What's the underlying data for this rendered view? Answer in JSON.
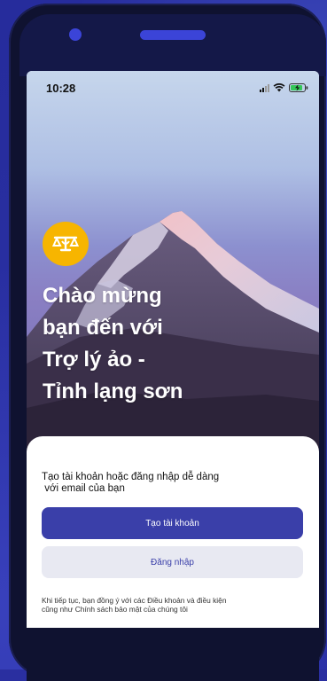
{
  "status_bar": {
    "time": "10:28",
    "icons": [
      "signal-icon",
      "wifi-icon",
      "battery-charging-icon"
    ]
  },
  "hero": {
    "badge_icon": "scales-icon",
    "title_lines": [
      "Chào mừng",
      "bạn đến với",
      "Trợ lý ảo -",
      "Tỉnh lạng sơn"
    ]
  },
  "sheet": {
    "subtitle_lines": [
      "Tạo tài khoản hoặc đăng nhập dễ dàng",
      " với email của bạn"
    ],
    "create_account_label": "Tạo tài khoản",
    "login_label": "Đăng nhập",
    "terms_lines": [
      "Khi tiếp tục, bạn đồng ý với các Điều khoản và điều kiện",
      "cũng như Chính sách bảo mật của chúng tôi"
    ]
  },
  "colors": {
    "background": "#2a2fa0",
    "primary": "#3a3fa9",
    "secondary_bg": "#e8e9f2",
    "badge": "#f7b500"
  }
}
